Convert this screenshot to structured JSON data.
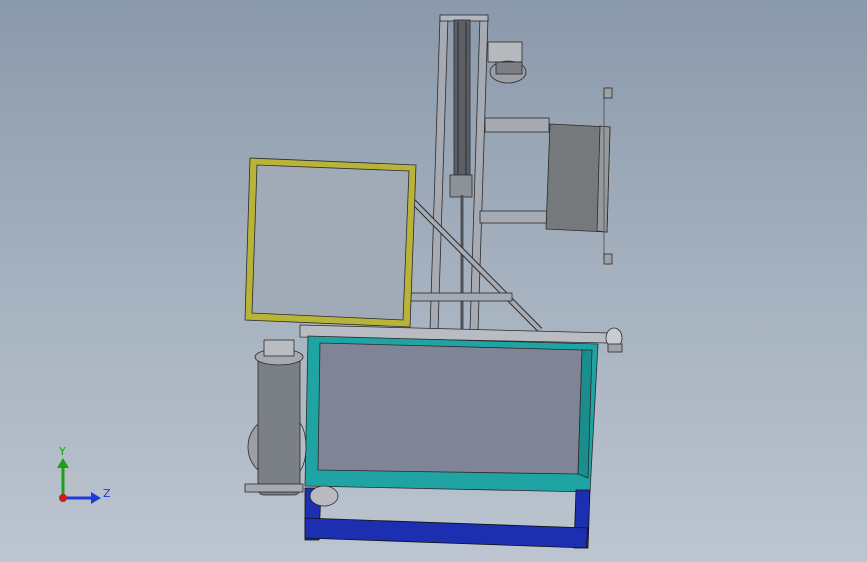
{
  "viewport": {
    "background_top": "#8a99ab",
    "background_bottom": "#bcc5d0"
  },
  "model": {
    "colors": {
      "frame_yellow": "#b8b43a",
      "frame_cyan": "#1fa3a3",
      "frame_blue": "#1c2fb0",
      "body_gray": "#7f8596",
      "steel": "#a6aab3",
      "panel_gray": "#76797c",
      "edge": "#2a2a2a"
    }
  },
  "triad": {
    "y_label": "Y",
    "z_label": "Z",
    "y_color": "#1aa31a",
    "z_color": "#1e3adb",
    "x_color": "#c81e1e"
  }
}
